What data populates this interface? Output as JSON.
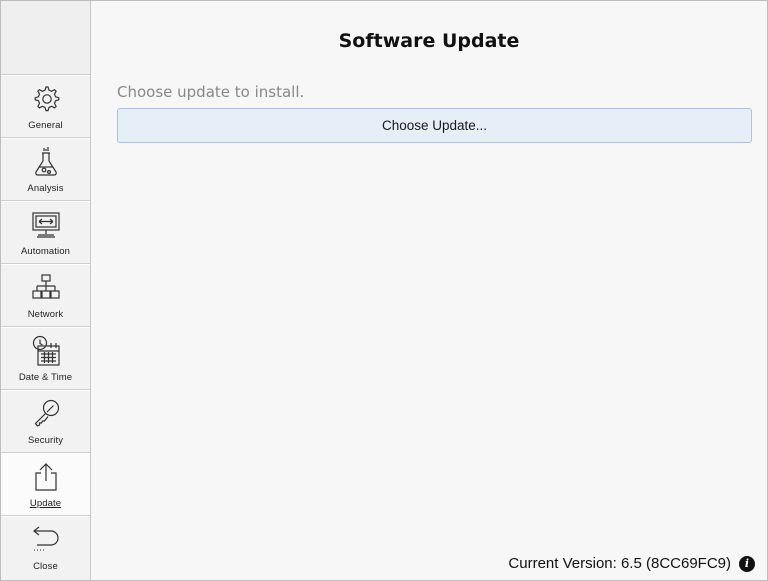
{
  "page": {
    "title": "Software Update"
  },
  "update": {
    "prompt": "Choose update to install.",
    "choose_button": "Choose Update..."
  },
  "footer": {
    "current_version": "Current Version: 6.5 (8CC69FC9)",
    "info_glyph": "i"
  },
  "sidebar": {
    "items": [
      {
        "label": "General",
        "icon": "gear-icon",
        "active": false
      },
      {
        "label": "Analysis",
        "icon": "flask-icon",
        "active": false
      },
      {
        "label": "Automation",
        "icon": "monitor-arrows-icon",
        "active": false
      },
      {
        "label": "Network",
        "icon": "network-tree-icon",
        "active": false
      },
      {
        "label": "Date & Time",
        "icon": "clock-calendar-icon",
        "active": false
      },
      {
        "label": "Security",
        "icon": "key-icon",
        "active": false
      },
      {
        "label": "Update",
        "icon": "upload-icon",
        "active": true
      },
      {
        "label": "Close",
        "icon": "back-arrow-icon",
        "active": false
      }
    ]
  }
}
